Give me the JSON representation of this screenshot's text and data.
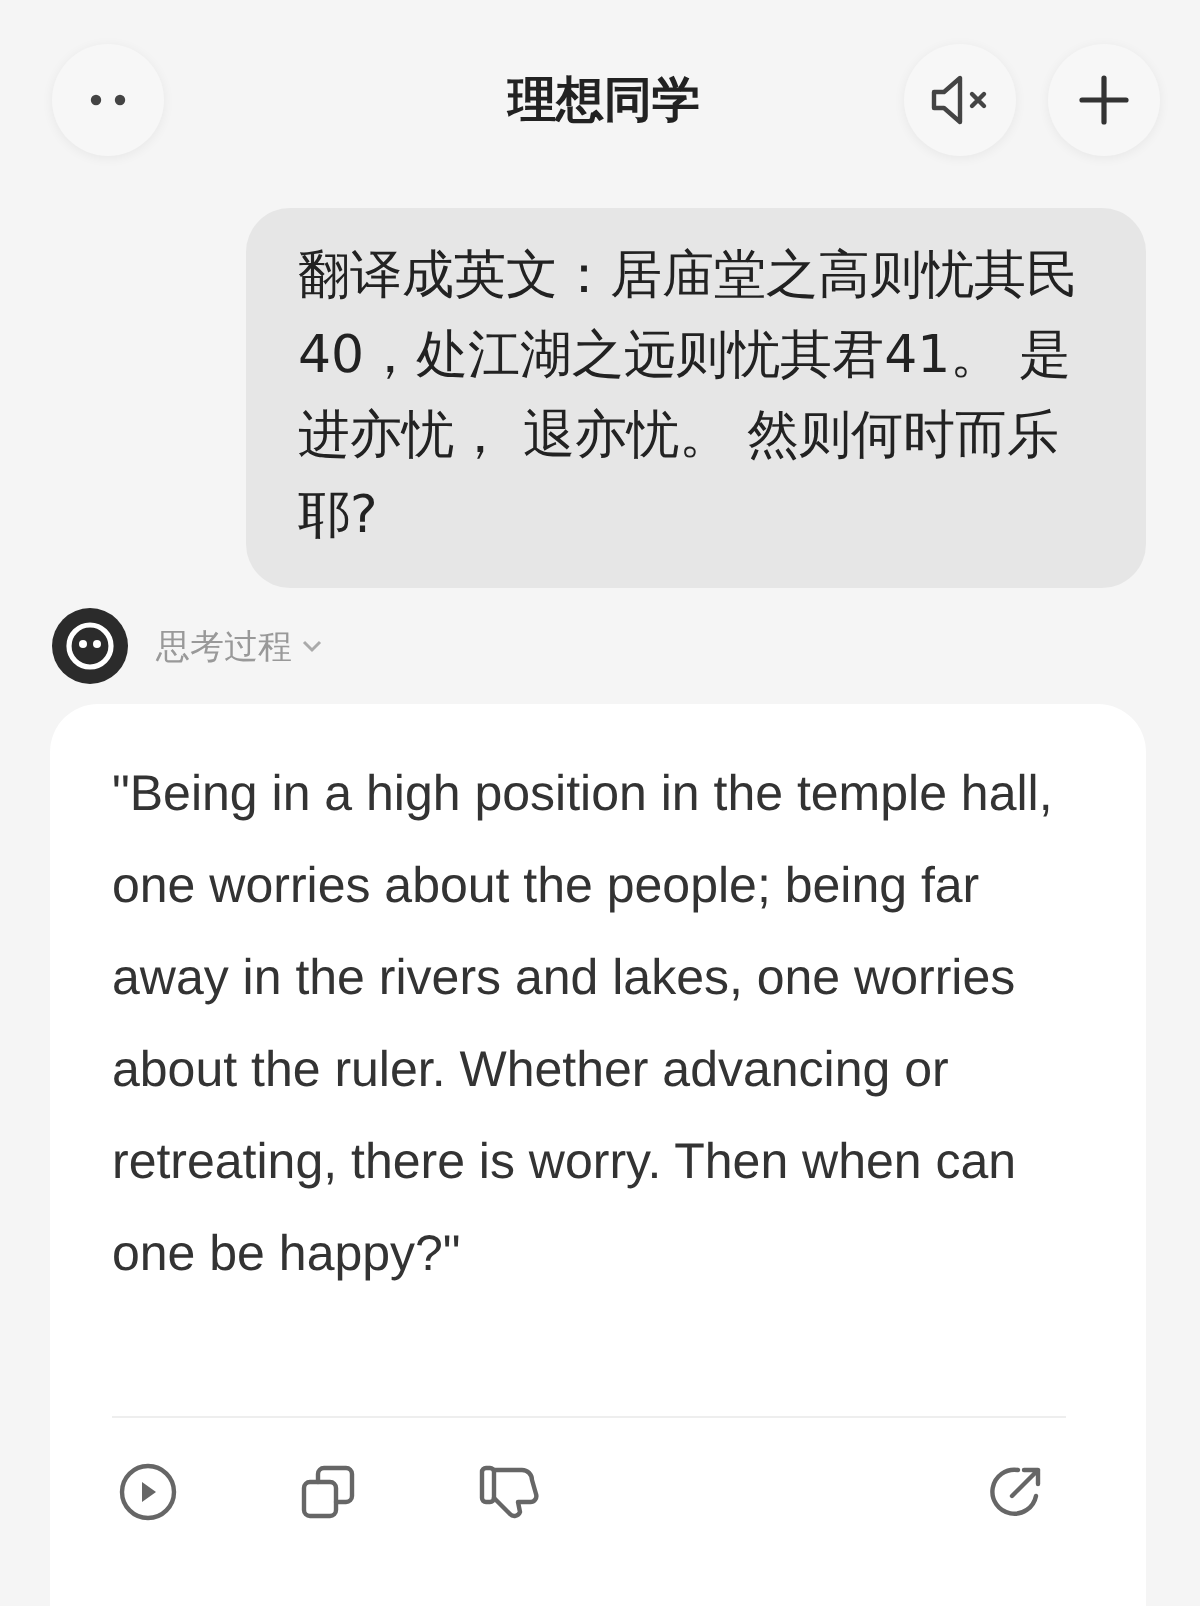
{
  "header": {
    "title": "理想同学"
  },
  "user_message": {
    "text": "翻译成英文：居庙堂之高则忧其民40，处江湖之远则忧其君41。 是进亦忧， 退亦忧。 然则何时而乐耶?"
  },
  "assistant": {
    "thinking_label": "思考过程",
    "expanded": false,
    "reply": "\"Being in a high position in the temple hall, one worries about the people; being far away in the rivers and lakes, one worries about the ruler. Whether advancing or retreating, there is worry. Then when can one be happy?\""
  }
}
